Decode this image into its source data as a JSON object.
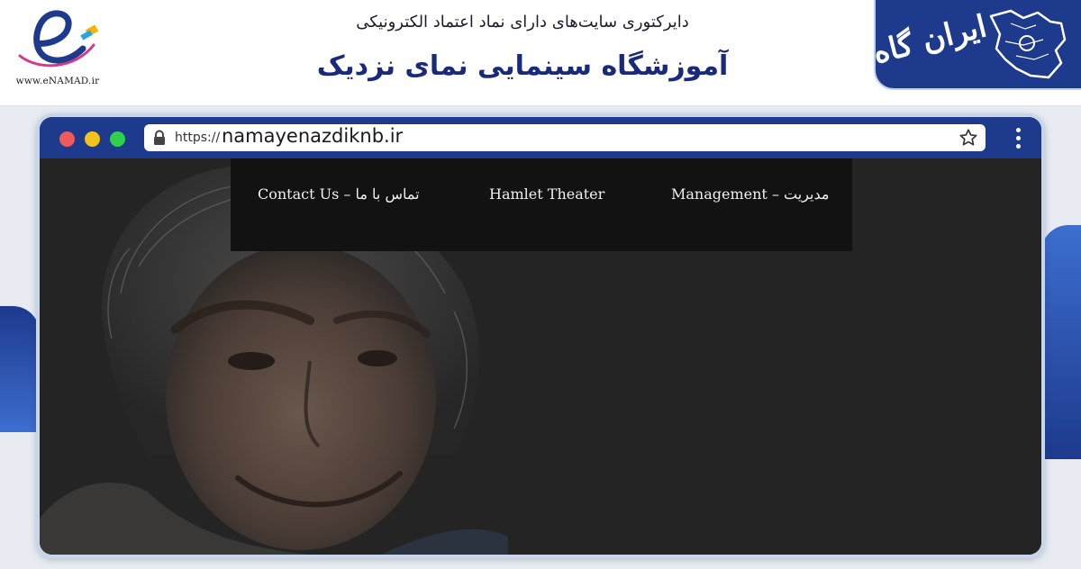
{
  "banner": {
    "subtitle": "دایرکتوری سایت‌های دارای نماد اعتماد الکترونیکی",
    "title": "آموزشگاه سینمایی نمای نزدیک",
    "enamad_url": "www.eNAMAD.ir",
    "logo_text": "ایران گاه",
    "accent": "#1d3a8c"
  },
  "browser": {
    "url_scheme": "https://",
    "url_domain": "namayenazdiknb.ir",
    "window_dots": [
      "#f25a5a",
      "#f5c21b",
      "#2fd04c"
    ],
    "icons": [
      "lock-icon",
      "star-icon",
      "menu-icon"
    ]
  },
  "site": {
    "nav": {
      "contact": "Contact Us – تماس با ما",
      "hamlet": "Hamlet Theater",
      "management": "Management – مدیریت"
    }
  }
}
